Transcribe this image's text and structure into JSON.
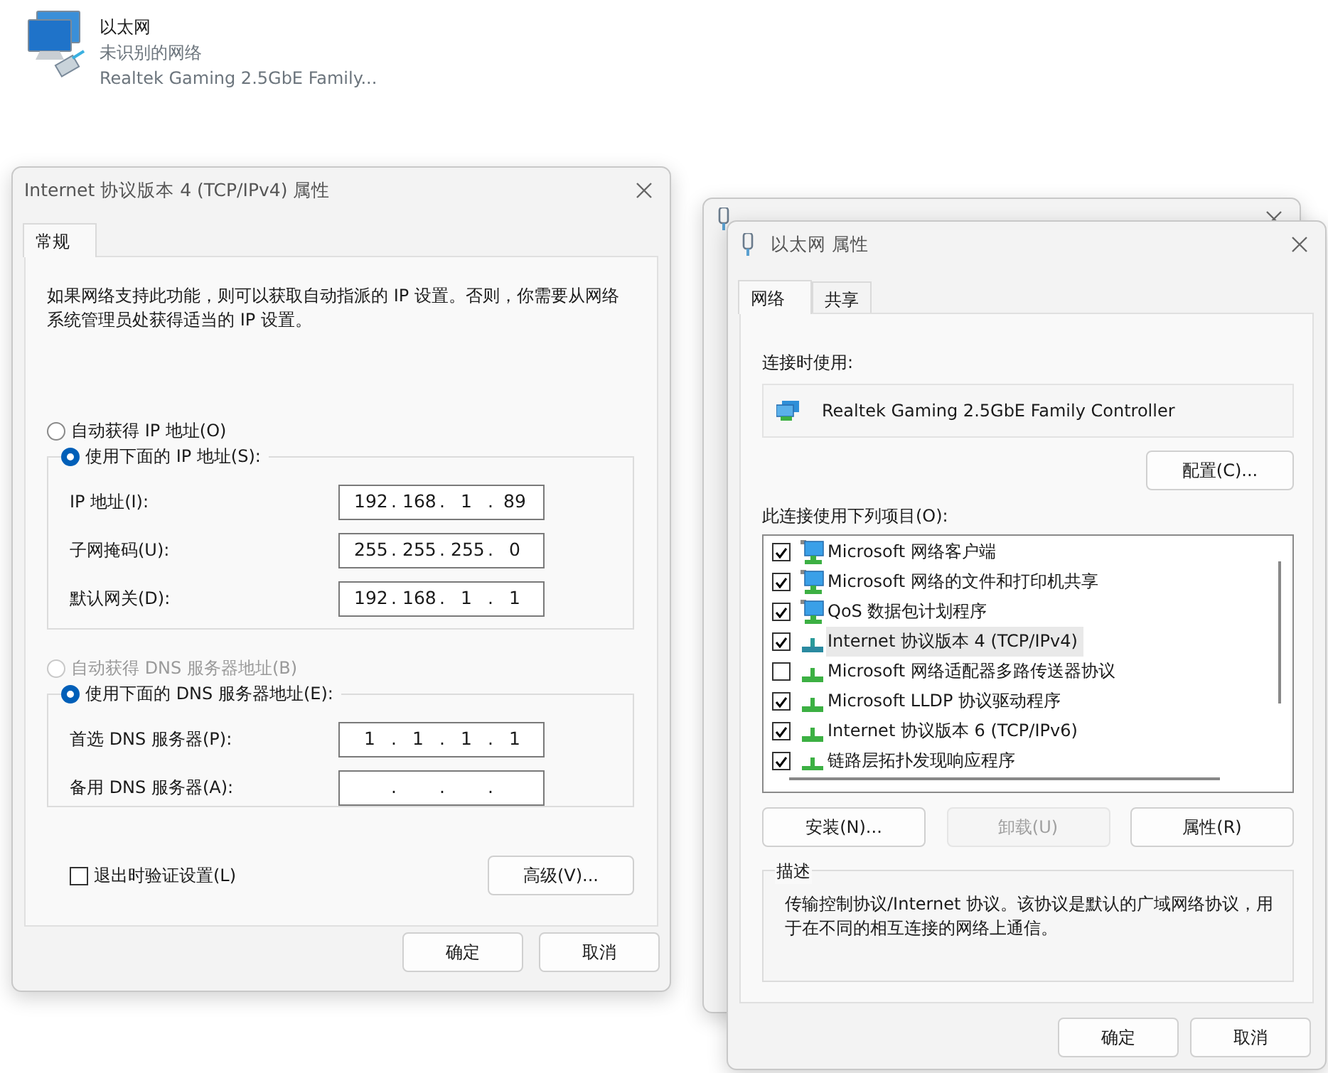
{
  "network_item": {
    "name": "以太网",
    "status": "未识别的网络",
    "adapter": "Realtek Gaming 2.5GbE Family..."
  },
  "ipv4_dialog": {
    "title": "Internet 协议版本 4 (TCP/IPv4) 属性",
    "tabs": [
      {
        "label": "常规",
        "selected": true
      }
    ],
    "intro": "如果网络支持此功能，则可以获取自动指派的 IP 设置。否则，你需要从网络系统管理员处获得适当的 IP 设置。",
    "ip_options": [
      {
        "label": "自动获得 IP 地址(O)",
        "selected": false,
        "disabled": false
      },
      {
        "label": "使用下面的 IP 地址(S):",
        "selected": true,
        "disabled": false
      }
    ],
    "ip_fields": [
      {
        "label": "IP 地址(I):",
        "octets": [
          "192",
          "168",
          "1",
          "89"
        ],
        "separators": [
          ".",
          ".",
          "."
        ]
      },
      {
        "label": "子网掩码(U):",
        "octets": [
          "255",
          "255",
          "255",
          "0"
        ],
        "separators": [
          ".",
          ".",
          "."
        ]
      },
      {
        "label": "默认网关(D):",
        "octets": [
          "192",
          "168",
          "1",
          "1"
        ],
        "separators": [
          ".",
          ".",
          "."
        ]
      }
    ],
    "dns_options": [
      {
        "label": "自动获得 DNS 服务器地址(B)",
        "selected": false,
        "disabled": true
      },
      {
        "label": "使用下面的 DNS 服务器地址(E):",
        "selected": true,
        "disabled": false
      }
    ],
    "dns_fields": [
      {
        "label": "首选 DNS 服务器(P):",
        "octets": [
          "1",
          "1",
          "1",
          "1"
        ],
        "separators": [
          ".",
          ".",
          "."
        ]
      },
      {
        "label": "备用 DNS 服务器(A):",
        "separators": [
          ".",
          ".",
          "."
        ]
      }
    ],
    "validate_checkbox": {
      "label": "退出时验证设置(L)",
      "checked": false
    },
    "advanced_button": "高级(V)...",
    "buttons": [
      "确定",
      "取消"
    ]
  },
  "properties_dialog": {
    "title": "以太网 属性",
    "tabs": [
      {
        "label": "网络",
        "selected": true
      },
      {
        "label": "共享",
        "selected": false
      }
    ],
    "connect_using_label": "连接时使用:",
    "adapter": "Realtek Gaming 2.5GbE Family Controller",
    "configure_button": "配置(C)...",
    "items_label": "此连接使用下列项目(O):",
    "items": [
      {
        "label": "Microsoft 网络客户端",
        "kind": "client",
        "checked": true,
        "selected": false
      },
      {
        "label": "Microsoft 网络的文件和打印机共享",
        "kind": "client",
        "checked": true,
        "selected": false
      },
      {
        "label": "QoS 数据包计划程序",
        "kind": "client",
        "checked": true,
        "selected": false
      },
      {
        "label": "Internet 协议版本 4 (TCP/IPv4)",
        "kind": "protocol",
        "checked": true,
        "selected": true
      },
      {
        "label": "Microsoft 网络适配器多路传送器协议",
        "kind": "protocol",
        "checked": false,
        "selected": false
      },
      {
        "label": "Microsoft LLDP 协议驱动程序",
        "kind": "protocol",
        "checked": true,
        "selected": false
      },
      {
        "label": "Internet 协议版本 6 (TCP/IPv6)",
        "kind": "protocol",
        "checked": true,
        "selected": false
      },
      {
        "label": "链路层拓扑发现响应程序",
        "kind": "protocol",
        "checked": true,
        "selected": false
      }
    ],
    "action_buttons": [
      {
        "label": "安装(N)...",
        "disabled": false
      },
      {
        "label": "卸载(U)",
        "disabled": true
      },
      {
        "label": "属性(R)",
        "disabled": false
      }
    ],
    "description_title": "描述",
    "description": "传输控制协议/Internet 协议。该协议是默认的广域网络协议，用于在不同的相互连接的网络上通信。",
    "buttons": [
      "确定",
      "取消"
    ]
  }
}
